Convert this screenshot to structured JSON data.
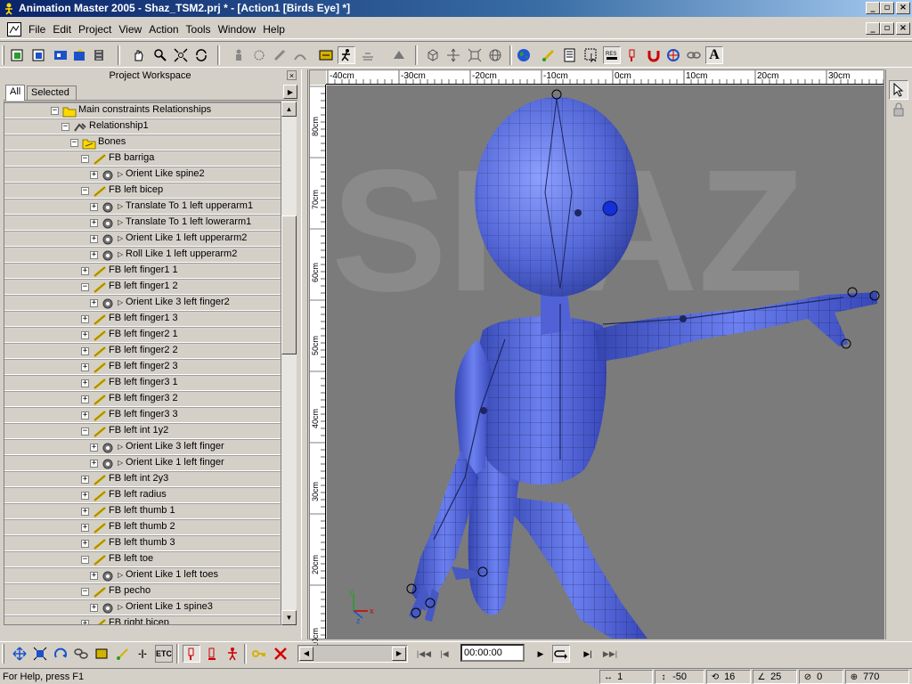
{
  "window": {
    "title": "Animation Master 2005 - Shaz_TSM2.prj * - [Action1 [Birds Eye] *]"
  },
  "menu": [
    "File",
    "Edit",
    "Project",
    "View",
    "Action",
    "Tools",
    "Window",
    "Help"
  ],
  "workspace": {
    "title": "Project Workspace",
    "tabs": [
      "All",
      "Selected"
    ]
  },
  "tree": [
    {
      "label": "Main constraints Relationships",
      "level": 0,
      "icon": "folder-icon",
      "expander": "minus"
    },
    {
      "label": "Relationship1",
      "level": 1,
      "icon": "relationship-icon",
      "expander": "minus"
    },
    {
      "label": "Bones",
      "level": 2,
      "icon": "bones-folder-icon",
      "expander": "minus"
    },
    {
      "label": "FB barriga",
      "level": 3,
      "icon": "bone-icon",
      "expander": "minus"
    },
    {
      "label": "Orient Like spine2",
      "level": 4,
      "icon": "constraint-gear-icon",
      "expander": "plus"
    },
    {
      "label": "FB left bicep",
      "level": 3,
      "icon": "bone-icon",
      "expander": "minus"
    },
    {
      "label": "Translate To 1 left upperarm1",
      "level": 4,
      "icon": "constraint-gear-icon",
      "expander": "plus"
    },
    {
      "label": "Translate To 1 left lowerarm1",
      "level": 4,
      "icon": "constraint-gear-icon",
      "expander": "plus"
    },
    {
      "label": "Orient Like 1 left upperarm2",
      "level": 4,
      "icon": "constraint-gear-icon",
      "expander": "plus"
    },
    {
      "label": "Roll Like 1 left upperarm2",
      "level": 4,
      "icon": "constraint-gear-icon",
      "expander": "plus"
    },
    {
      "label": "FB left finger1 1",
      "level": 3,
      "icon": "bone-icon",
      "expander": "plus"
    },
    {
      "label": "FB left finger1 2",
      "level": 3,
      "icon": "bone-icon",
      "expander": "minus"
    },
    {
      "label": "Orient Like 3 left finger2",
      "level": 4,
      "icon": "constraint-gear-icon",
      "expander": "plus"
    },
    {
      "label": "FB left finger1 3",
      "level": 3,
      "icon": "bone-icon",
      "expander": "plus"
    },
    {
      "label": "FB left finger2 1",
      "level": 3,
      "icon": "bone-icon",
      "expander": "plus"
    },
    {
      "label": "FB left finger2 2",
      "level": 3,
      "icon": "bone-icon",
      "expander": "plus"
    },
    {
      "label": "FB left finger2 3",
      "level": 3,
      "icon": "bone-icon",
      "expander": "plus"
    },
    {
      "label": "FB left finger3 1",
      "level": 3,
      "icon": "bone-icon",
      "expander": "plus"
    },
    {
      "label": "FB left finger3 2",
      "level": 3,
      "icon": "bone-icon",
      "expander": "plus"
    },
    {
      "label": "FB left finger3 3",
      "level": 3,
      "icon": "bone-icon",
      "expander": "plus"
    },
    {
      "label": "FB left int 1y2",
      "level": 3,
      "icon": "bone-icon",
      "expander": "minus"
    },
    {
      "label": "Orient Like 3 left finger",
      "level": 4,
      "icon": "constraint-gear-icon",
      "expander": "plus"
    },
    {
      "label": "Orient Like 1 left finger",
      "level": 4,
      "icon": "constraint-gear-icon",
      "expander": "plus"
    },
    {
      "label": "FB left int 2y3",
      "level": 3,
      "icon": "bone-icon",
      "expander": "plus"
    },
    {
      "label": "FB left radius",
      "level": 3,
      "icon": "bone-icon",
      "expander": "plus"
    },
    {
      "label": "FB left thumb 1",
      "level": 3,
      "icon": "bone-icon",
      "expander": "plus"
    },
    {
      "label": "FB left thumb 2",
      "level": 3,
      "icon": "bone-icon",
      "expander": "plus"
    },
    {
      "label": "FB left thumb 3",
      "level": 3,
      "icon": "bone-icon",
      "expander": "plus"
    },
    {
      "label": "FB left toe",
      "level": 3,
      "icon": "bone-icon",
      "expander": "minus"
    },
    {
      "label": "Orient Like 1 left toes",
      "level": 4,
      "icon": "constraint-gear-icon",
      "expander": "plus"
    },
    {
      "label": "FB pecho",
      "level": 3,
      "icon": "bone-icon",
      "expander": "minus"
    },
    {
      "label": "Orient Like 1 spine3",
      "level": 4,
      "icon": "constraint-gear-icon",
      "expander": "plus"
    },
    {
      "label": "FB right bicep",
      "level": 3,
      "icon": "bone-icon",
      "expander": "plus"
    }
  ],
  "ruler": {
    "top": [
      "-40cm",
      "-30cm",
      "-20cm",
      "-10cm",
      "0cm",
      "10cm",
      "20cm",
      "30cm"
    ],
    "left": [
      "80cm",
      "70cm",
      "60cm",
      "50cm",
      "40cm",
      "30cm",
      "20cm",
      "10cm"
    ]
  },
  "viewport": {
    "watermark": "SHAZ",
    "axis_labels": [
      "y",
      "z",
      "x"
    ]
  },
  "timeline": {
    "time": "00:00:00"
  },
  "toolbar_text": {
    "constraint": "-|-",
    "etc": "ETC",
    "text_tool": "A"
  },
  "status": {
    "help": "For Help, press F1",
    "fields": [
      "1",
      "-50",
      "16",
      "25",
      "0",
      "770"
    ]
  },
  "colors": {
    "model": "#5a6fe0",
    "viewport_bg": "#7b7b7b",
    "titlebar": "#0a246a"
  }
}
